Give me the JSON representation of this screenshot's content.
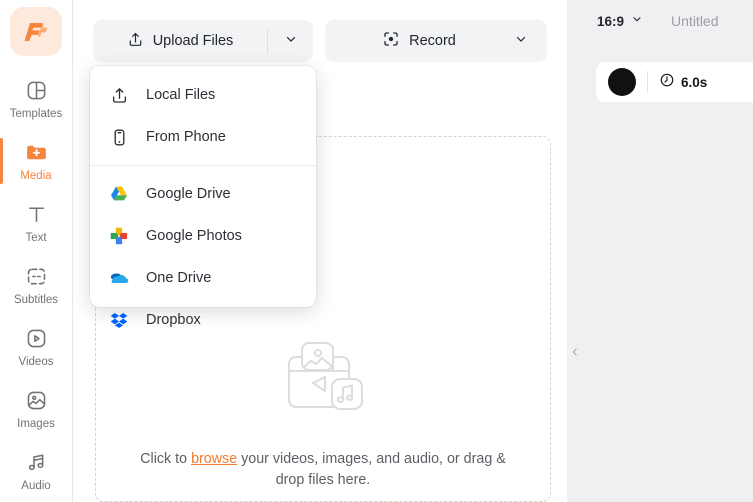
{
  "app": {
    "logo_name": "flexclip-logo"
  },
  "sidebar": {
    "items": [
      {
        "label": "Templates",
        "icon": "templates-icon",
        "active": false
      },
      {
        "label": "Media",
        "icon": "media-folder-plus-icon",
        "active": true
      },
      {
        "label": "Text",
        "icon": "text-icon",
        "active": false
      },
      {
        "label": "Subtitles",
        "icon": "subtitles-icon",
        "active": false
      },
      {
        "label": "Videos",
        "icon": "videos-play-icon",
        "active": false
      },
      {
        "label": "Images",
        "icon": "images-icon",
        "active": false
      },
      {
        "label": "Audio",
        "icon": "audio-note-icon",
        "active": false
      }
    ]
  },
  "toolbar": {
    "upload_label": "Upload Files",
    "upload_icon": "upload-arrow-icon",
    "upload_caret_icon": "chevron-down-icon",
    "record_label": "Record",
    "record_icon": "record-target-icon",
    "record_caret_icon": "chevron-down-icon"
  },
  "upload_menu": {
    "items": [
      {
        "label": "Local Files",
        "icon": "upload-arrow-icon"
      },
      {
        "label": "From Phone",
        "icon": "phone-icon"
      },
      {
        "label": "Google Drive",
        "icon": "google-drive-icon"
      },
      {
        "label": "Google Photos",
        "icon": "google-photos-icon"
      },
      {
        "label": "One Drive",
        "icon": "onedrive-cloud-icon"
      },
      {
        "label": "Dropbox",
        "icon": "dropbox-icon"
      }
    ],
    "separator_after_index": 1
  },
  "dropzone": {
    "icon": "media-stack-icon",
    "text_before": "Click to ",
    "link": "browse",
    "text_after": " your videos, images, and audio, or drag & drop files here."
  },
  "collapse": {
    "icon": "chevron-left-icon"
  },
  "right_panel": {
    "aspect_ratio": "16:9",
    "aspect_caret_icon": "chevron-down-icon",
    "project_title": "Untitled",
    "clip": {
      "thumbnail": "clip-thumbnail",
      "duration_icon": "clock-icon",
      "duration": "6.0s"
    }
  },
  "colors": {
    "accent": "#f5853f",
    "link": "#f07b2e",
    "panel_bg": "#f0f0f3",
    "button_bg": "#f2f3f5"
  }
}
